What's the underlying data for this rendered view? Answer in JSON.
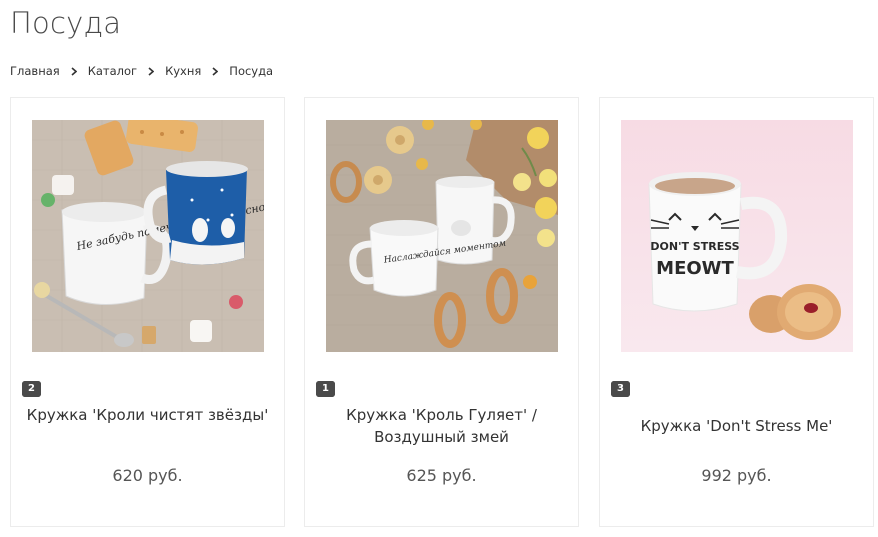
{
  "page": {
    "title": "Посуда"
  },
  "breadcrumb": [
    {
      "label": "Главная"
    },
    {
      "label": "Каталог"
    },
    {
      "label": "Кухня"
    },
    {
      "label": "Посуда"
    }
  ],
  "products": [
    {
      "badge": "2",
      "name": "Кружка 'Кроли чистят звёзды'",
      "price": "620 руб.",
      "mug_text": "Не забудь помечтать перед сном"
    },
    {
      "badge": "1",
      "name": "Кружка 'Кроль Гуляет' / Воздушный змей",
      "price": "625 руб.",
      "mug_text": "Наслаждайся моментом"
    },
    {
      "badge": "3",
      "name": "Кружка 'Don't Stress Me'",
      "price": "992 руб.",
      "mug_text_1": "DON'T STRESS",
      "mug_text_2": "MEOWT"
    }
  ],
  "colors": {
    "badge_bg": "#4a4a4a",
    "card_border": "#ececec",
    "text": "#333333",
    "price": "#555555",
    "pink_bg": "#f7dfe6",
    "linen_bg": "#c9beb2"
  }
}
